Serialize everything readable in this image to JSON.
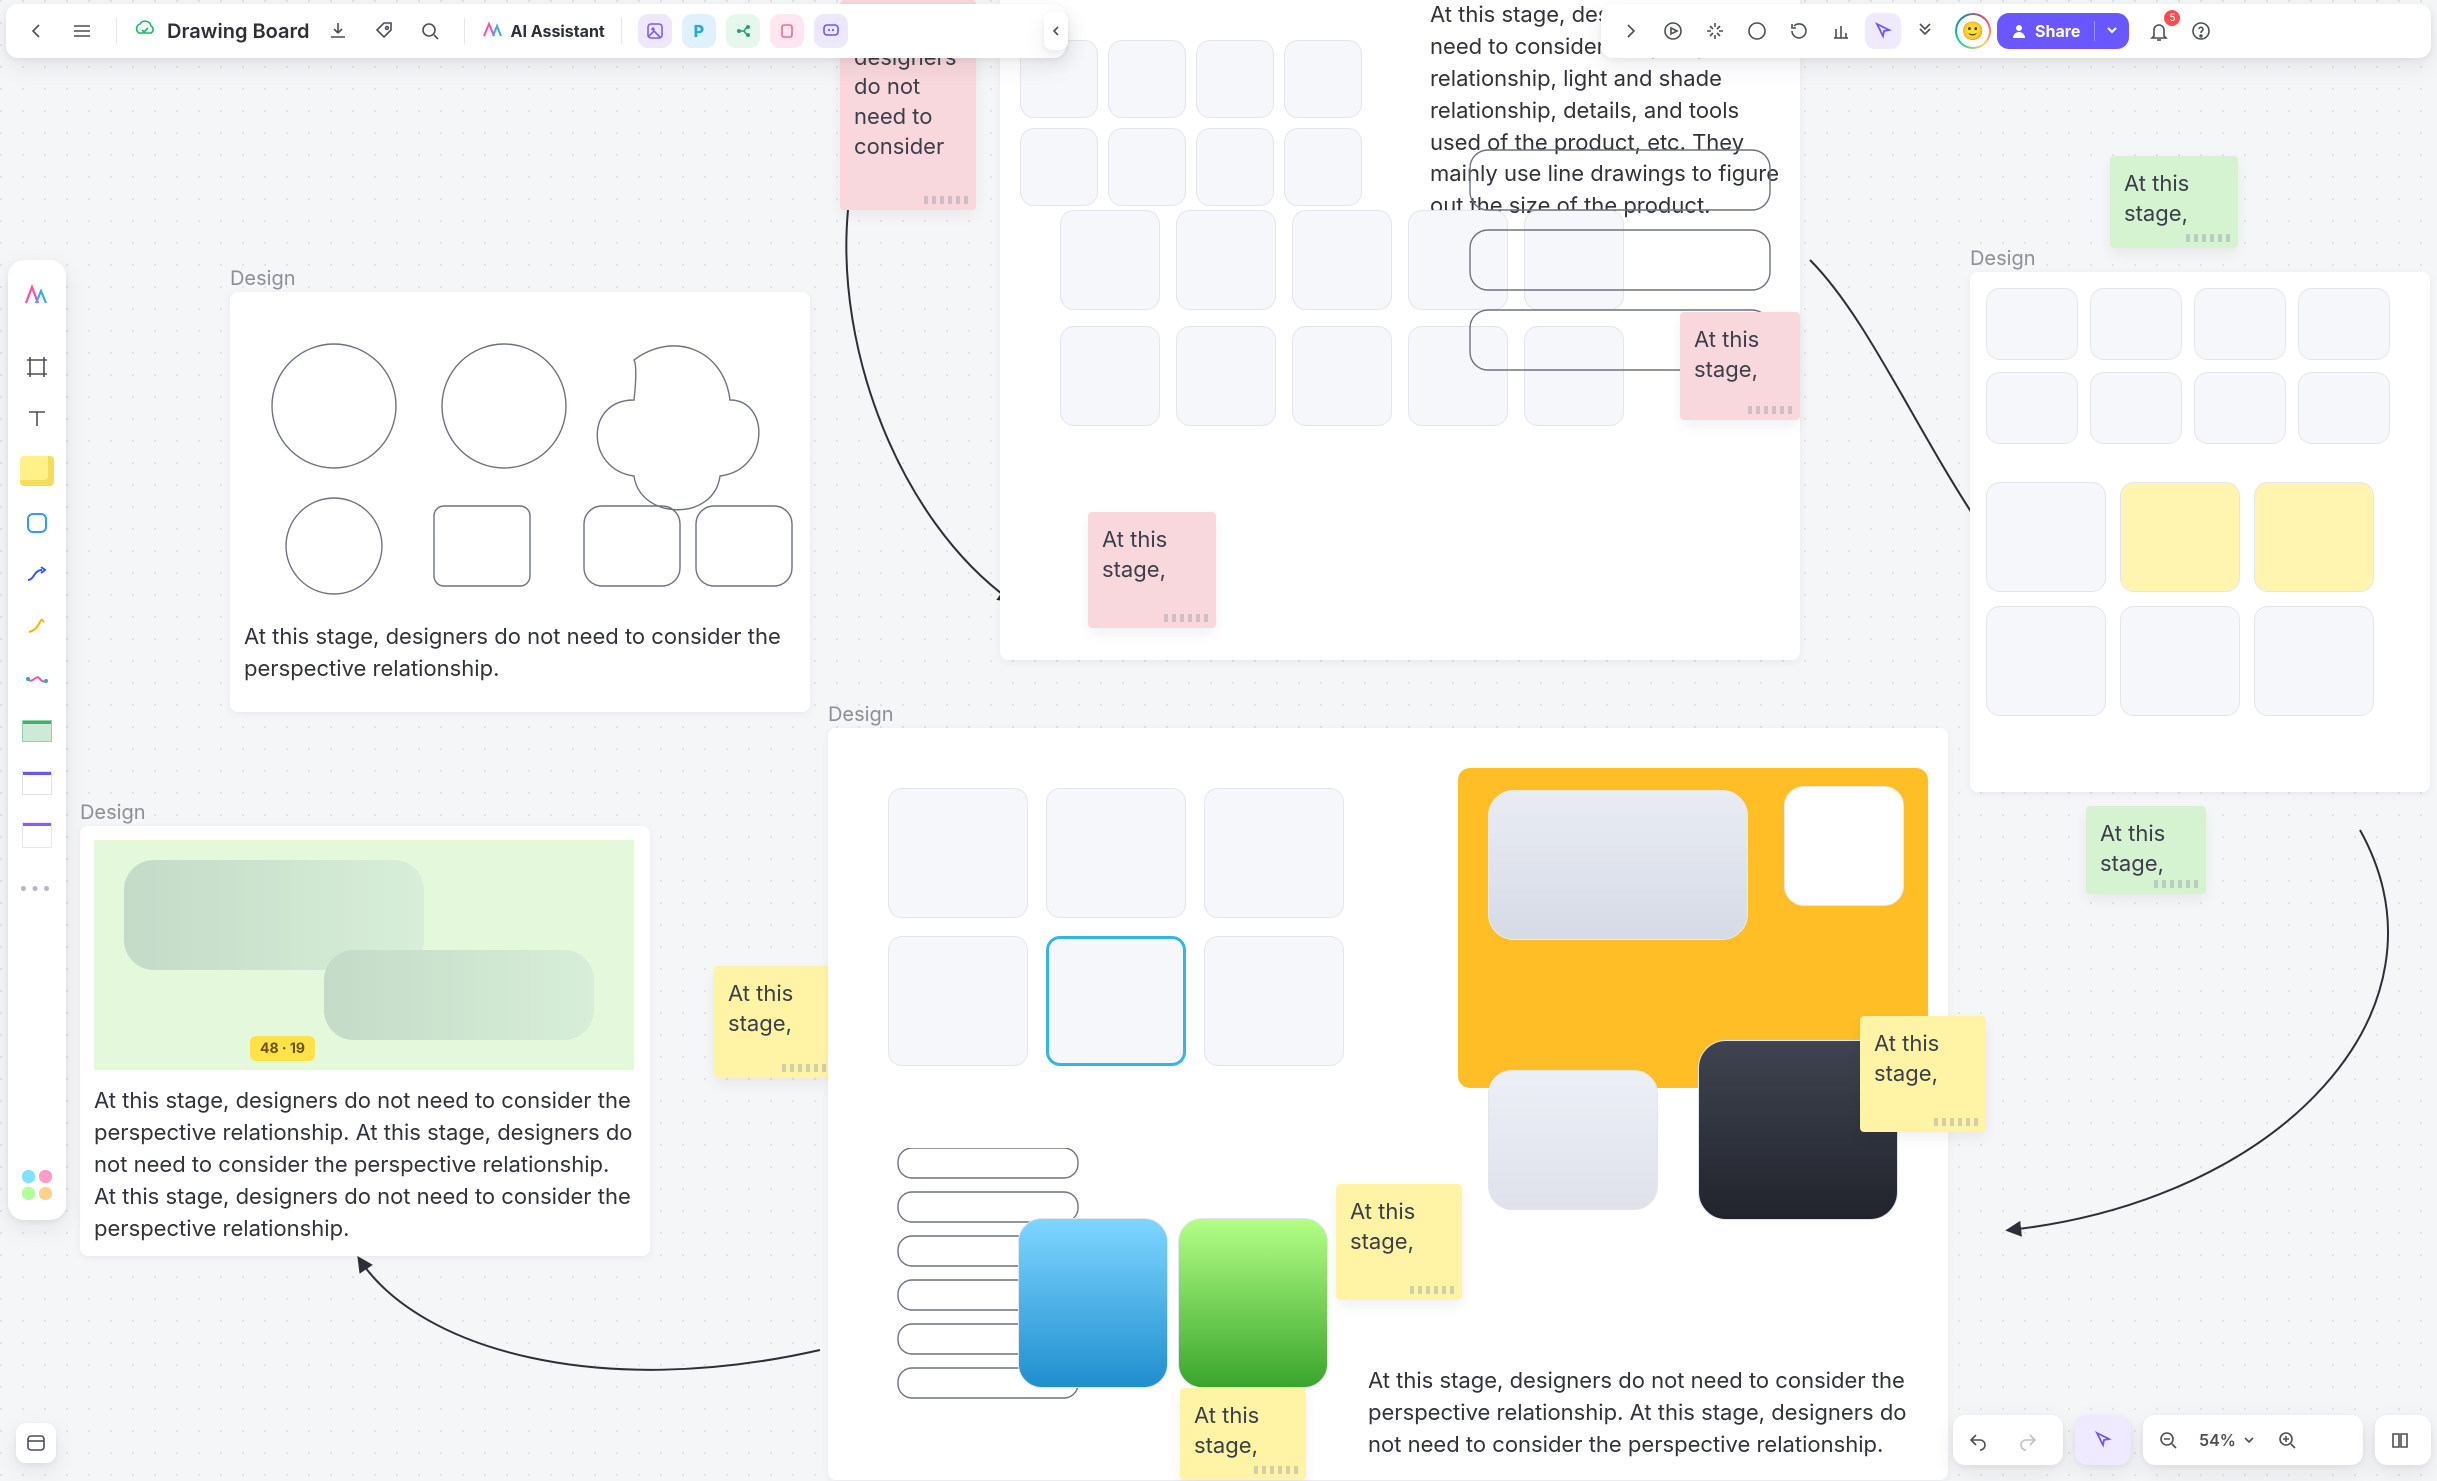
{
  "header": {
    "back": "Back",
    "title": "Drawing Board",
    "ai_label": "AI Assistant",
    "cloud_label": "Synced",
    "chips": [
      "image",
      "poster",
      "mindmap",
      "pink",
      "chat"
    ]
  },
  "right_bar": {
    "play": "Present",
    "share_label": "Share",
    "notifications_count": "5"
  },
  "zoom": {
    "value": "54%"
  },
  "notes": {
    "pink_top": "stage, designers do not need to consider",
    "pink_mid_right": "At this stage,",
    "pink_mid_left": "At this stage,",
    "green_top": "At this stage,",
    "green_mid": "At this stage,",
    "yellow_left": "At this stage,",
    "yellow_right_upper": "At this stage,",
    "yellow_center": "At this stage,",
    "yellow_bottom": "At this stage,"
  },
  "frames": {
    "f1": {
      "label": "Design",
      "caption": "At this stage, designers do not need to consider the perspective relationship."
    },
    "f2": {
      "label": "Design",
      "caption": "At this stage, designers do not need to consider the perspective relationship. At this stage, designers do not need to consider the perspective relationship. At this stage, designers do not need to consider the perspective relationship."
    },
    "f3": {
      "label": "Design",
      "captionTop": "At this stage, designers do not need to consider the perspective relationship, light and shade relationship, details, and tools used of the product, etc. They mainly use line drawings to figure out the size of the product.",
      "captionBottom": "At this stage, designers do not need to consider the perspective relationship. At this stage, designers do not need to consider the perspective relationship."
    },
    "f4": {
      "label": "Design"
    }
  },
  "left_tools": {
    "logo": "logo",
    "frame": "frame",
    "text": "text",
    "sticky": "sticky-note",
    "shape": "shape",
    "connector": "connector",
    "pen": "pen",
    "draw": "draw",
    "table": "table",
    "block": "text-block",
    "list": "list",
    "more": "more",
    "apps": "apps"
  }
}
